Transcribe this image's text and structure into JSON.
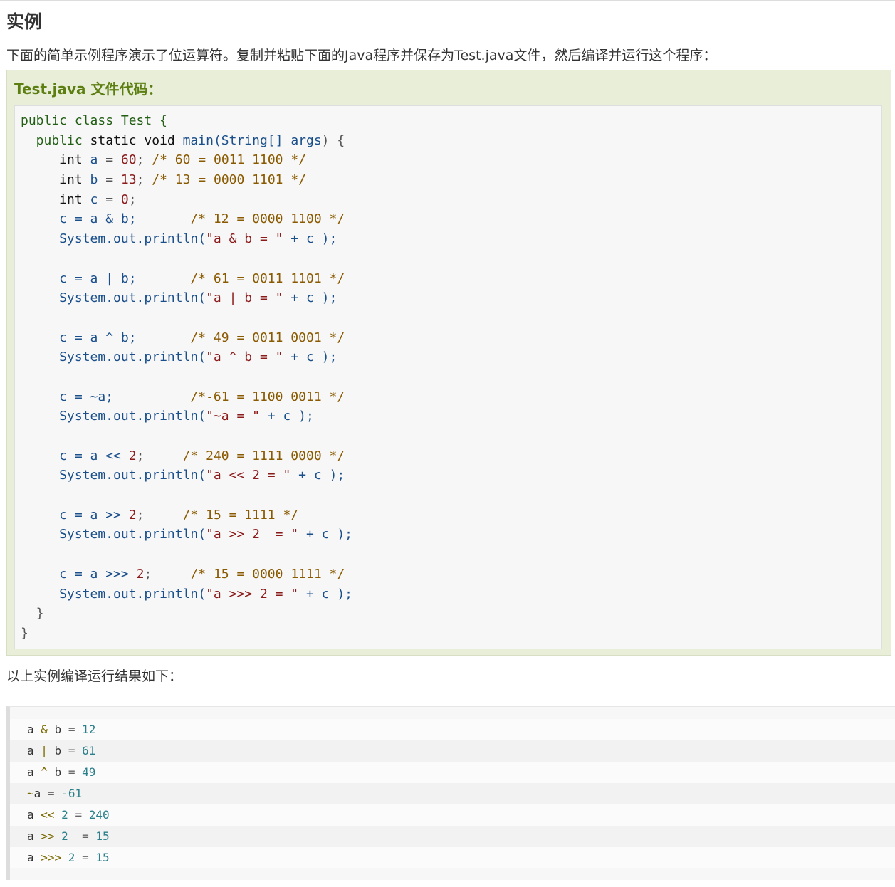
{
  "section": {
    "heading": "实例",
    "intro": "下面的简单示例程序演示了位运算符。复制并粘贴下面的Java程序并保存为Test.java文件，然后编译并运行这个程序：",
    "outro": "以上实例编译运行结果如下："
  },
  "example": {
    "title": "Test.java 文件代码：",
    "code_lines": [
      [
        {
          "t": "public class Test {",
          "c": "#225f14"
        }
      ],
      [
        {
          "t": "  public ",
          "c": "#225f14"
        },
        {
          "t": "static void ",
          "c": "#111111"
        },
        {
          "t": "main(",
          "c": "#1a4f8b"
        },
        {
          "t": "String[] args",
          "c": "#1a4f8b"
        },
        {
          "t": ") {",
          "c": "#555555"
        }
      ],
      [
        {
          "t": "     int ",
          "c": "#111111"
        },
        {
          "t": "a",
          "c": "#1a4f8b"
        },
        {
          "t": " = ",
          "c": "#555555"
        },
        {
          "t": "60",
          "c": "#8b1a1a"
        },
        {
          "t": "; ",
          "c": "#555555"
        },
        {
          "t": "/* 60 = 0011 1100 */",
          "c": "#8a5a00"
        }
      ],
      [
        {
          "t": "     int ",
          "c": "#111111"
        },
        {
          "t": "b",
          "c": "#1a4f8b"
        },
        {
          "t": " = ",
          "c": "#555555"
        },
        {
          "t": "13",
          "c": "#8b1a1a"
        },
        {
          "t": "; ",
          "c": "#555555"
        },
        {
          "t": "/* 13 = 0000 1101 */",
          "c": "#8a5a00"
        }
      ],
      [
        {
          "t": "     int ",
          "c": "#111111"
        },
        {
          "t": "c",
          "c": "#1a4f8b"
        },
        {
          "t": " = ",
          "c": "#555555"
        },
        {
          "t": "0",
          "c": "#8b1a1a"
        },
        {
          "t": ";",
          "c": "#555555"
        }
      ],
      [
        {
          "t": "     c = a & b;       ",
          "c": "#1a4f8b"
        },
        {
          "t": "/* 12 = 0000 1100 */",
          "c": "#8a5a00"
        }
      ],
      [
        {
          "t": "     System.out.println(",
          "c": "#1a4f8b"
        },
        {
          "t": "\"a & b = \"",
          "c": "#8b1a1a"
        },
        {
          "t": " + c );",
          "c": "#1a4f8b"
        }
      ],
      [
        {
          "t": " ",
          "c": "#555555"
        }
      ],
      [
        {
          "t": "     c = a | b;       ",
          "c": "#1a4f8b"
        },
        {
          "t": "/* 61 = 0011 1101 */",
          "c": "#8a5a00"
        }
      ],
      [
        {
          "t": "     System.out.println(",
          "c": "#1a4f8b"
        },
        {
          "t": "\"a | b = \"",
          "c": "#8b1a1a"
        },
        {
          "t": " + c );",
          "c": "#1a4f8b"
        }
      ],
      [
        {
          "t": " ",
          "c": "#555555"
        }
      ],
      [
        {
          "t": "     c = a ^ b;       ",
          "c": "#1a4f8b"
        },
        {
          "t": "/* 49 = 0011 0001 */",
          "c": "#8a5a00"
        }
      ],
      [
        {
          "t": "     System.out.println(",
          "c": "#1a4f8b"
        },
        {
          "t": "\"a ^ b = \"",
          "c": "#8b1a1a"
        },
        {
          "t": " + c );",
          "c": "#1a4f8b"
        }
      ],
      [
        {
          "t": " ",
          "c": "#555555"
        }
      ],
      [
        {
          "t": "     c = ~a;          ",
          "c": "#1a4f8b"
        },
        {
          "t": "/*-61 = 1100 0011 */",
          "c": "#8a5a00"
        }
      ],
      [
        {
          "t": "     System.out.println(",
          "c": "#1a4f8b"
        },
        {
          "t": "\"~a = \"",
          "c": "#8b1a1a"
        },
        {
          "t": " + c );",
          "c": "#1a4f8b"
        }
      ],
      [
        {
          "t": " ",
          "c": "#555555"
        }
      ],
      [
        {
          "t": "     c = a << ",
          "c": "#1a4f8b"
        },
        {
          "t": "2",
          "c": "#8b1a1a"
        },
        {
          "t": ";     ",
          "c": "#555555"
        },
        {
          "t": "/* 240 = 1111 0000 */",
          "c": "#8a5a00"
        }
      ],
      [
        {
          "t": "     System.out.println(",
          "c": "#1a4f8b"
        },
        {
          "t": "\"a << 2 = \"",
          "c": "#8b1a1a"
        },
        {
          "t": " + c );",
          "c": "#1a4f8b"
        }
      ],
      [
        {
          "t": " ",
          "c": "#555555"
        }
      ],
      [
        {
          "t": "     c = a >> ",
          "c": "#1a4f8b"
        },
        {
          "t": "2",
          "c": "#8b1a1a"
        },
        {
          "t": ";     ",
          "c": "#555555"
        },
        {
          "t": "/* 15 = 1111 */",
          "c": "#8a5a00"
        }
      ],
      [
        {
          "t": "     System.out.println(",
          "c": "#1a4f8b"
        },
        {
          "t": "\"a >> 2  = \"",
          "c": "#8b1a1a"
        },
        {
          "t": " + c );",
          "c": "#1a4f8b"
        }
      ],
      [
        {
          "t": " ",
          "c": "#555555"
        }
      ],
      [
        {
          "t": "     c = a >>> ",
          "c": "#1a4f8b"
        },
        {
          "t": "2",
          "c": "#8b1a1a"
        },
        {
          "t": ";     ",
          "c": "#555555"
        },
        {
          "t": "/* 15 = 0000 1111 */",
          "c": "#8a5a00"
        }
      ],
      [
        {
          "t": "     System.out.println(",
          "c": "#1a4f8b"
        },
        {
          "t": "\"a >>> 2 = \"",
          "c": "#8b1a1a"
        },
        {
          "t": " + c );",
          "c": "#1a4f8b"
        }
      ],
      [
        {
          "t": "  }",
          "c": "#555555"
        }
      ],
      [
        {
          "t": "}",
          "c": "#555555"
        }
      ]
    ]
  },
  "output": {
    "lines": [
      [
        {
          "t": "a ",
          "c": "#333333"
        },
        {
          "t": "&",
          "c": "#7a6a00"
        },
        {
          "t": " b ",
          "c": "#333333"
        },
        {
          "t": "=",
          "c": "#666666"
        },
        {
          "t": " 12",
          "c": "#2a7f8a"
        }
      ],
      [
        {
          "t": "a ",
          "c": "#333333"
        },
        {
          "t": "|",
          "c": "#7a6a00"
        },
        {
          "t": " b ",
          "c": "#333333"
        },
        {
          "t": "=",
          "c": "#666666"
        },
        {
          "t": " 61",
          "c": "#2a7f8a"
        }
      ],
      [
        {
          "t": "a ",
          "c": "#333333"
        },
        {
          "t": "^",
          "c": "#7a6a00"
        },
        {
          "t": " b ",
          "c": "#333333"
        },
        {
          "t": "=",
          "c": "#666666"
        },
        {
          "t": " 49",
          "c": "#2a7f8a"
        }
      ],
      [
        {
          "t": "~",
          "c": "#7a6a00"
        },
        {
          "t": "a ",
          "c": "#333333"
        },
        {
          "t": "=",
          "c": "#666666"
        },
        {
          "t": " -61",
          "c": "#2a7f8a"
        }
      ],
      [
        {
          "t": "a ",
          "c": "#333333"
        },
        {
          "t": "<<",
          "c": "#7a6a00"
        },
        {
          "t": " 2 ",
          "c": "#2a7f8a"
        },
        {
          "t": "=",
          "c": "#666666"
        },
        {
          "t": " 240",
          "c": "#2a7f8a"
        }
      ],
      [
        {
          "t": "a ",
          "c": "#333333"
        },
        {
          "t": ">>",
          "c": "#7a6a00"
        },
        {
          "t": " 2  ",
          "c": "#2a7f8a"
        },
        {
          "t": "=",
          "c": "#666666"
        },
        {
          "t": " 15",
          "c": "#2a7f8a"
        }
      ],
      [
        {
          "t": "a ",
          "c": "#333333"
        },
        {
          "t": ">>>",
          "c": "#7a6a00"
        },
        {
          "t": " 2 ",
          "c": "#2a7f8a"
        },
        {
          "t": "=",
          "c": "#666666"
        },
        {
          "t": " 15",
          "c": "#2a7f8a"
        }
      ]
    ]
  }
}
